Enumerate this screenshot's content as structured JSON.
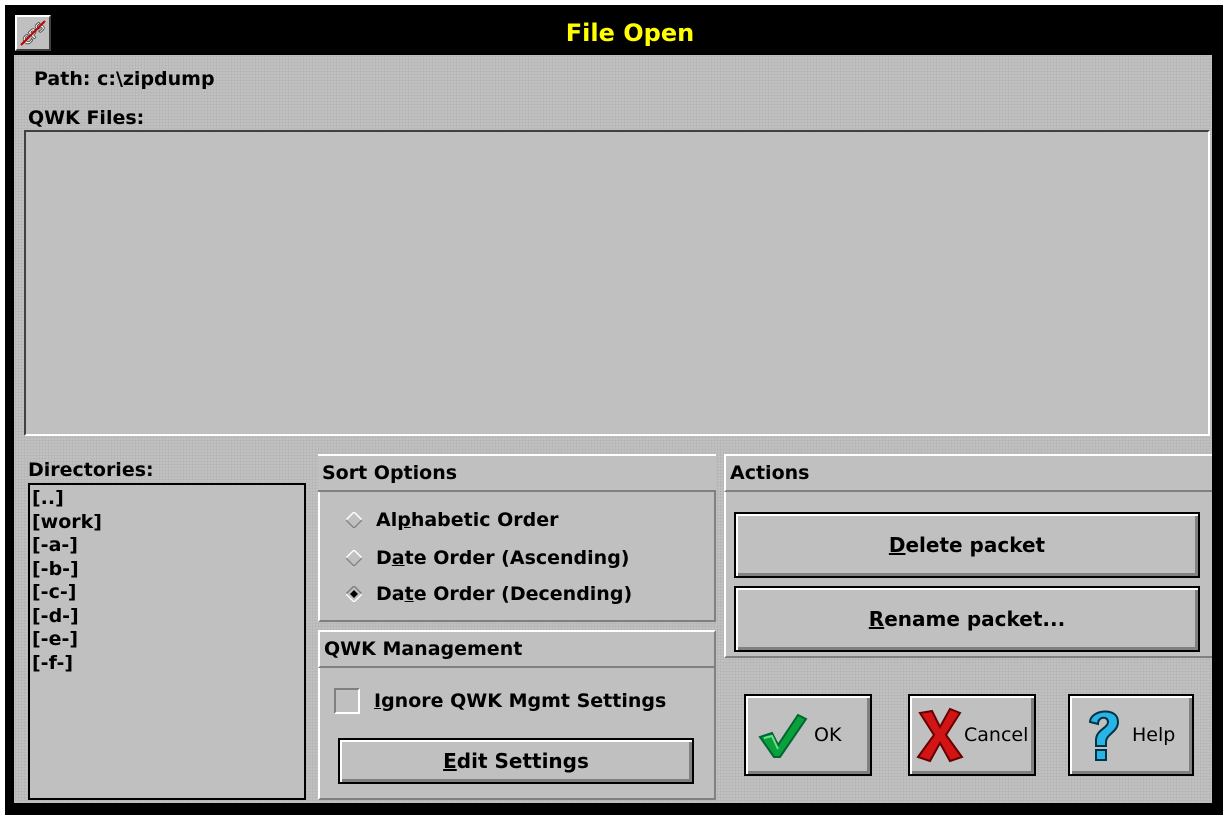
{
  "window": {
    "title": "File Open",
    "system_menu_icon": "cps-logo-icon"
  },
  "path": {
    "label": "Path:",
    "value": "c:\\zipdump"
  },
  "qwk_files": {
    "label": "QWK Files:",
    "items": []
  },
  "directories": {
    "label": "Directories:",
    "items": [
      "[..]",
      "[work]",
      "[-a-]",
      "[-b-]",
      "[-c-]",
      "[-d-]",
      "[-e-]",
      "[-f-]"
    ]
  },
  "sort_options": {
    "label": "Sort Options",
    "options": [
      {
        "pre": "Al",
        "mn": "p",
        "post": "habetic Order",
        "selected": false
      },
      {
        "pre": "D",
        "mn": "a",
        "post": "te Order (Ascending)",
        "selected": false
      },
      {
        "pre": "Da",
        "mn": "t",
        "post": "e Order (Decending)",
        "selected": true
      }
    ]
  },
  "qwk_management": {
    "label": "QWK Management",
    "ignore_checkbox": {
      "mn": "I",
      "post": "gnore QWK Mgmt Settings",
      "checked": false
    },
    "edit_button": {
      "mn": "E",
      "post": "dit Settings"
    }
  },
  "actions": {
    "label": "Actions",
    "delete_button": {
      "mn": "D",
      "post": "elete packet"
    },
    "rename_button": {
      "mn": "R",
      "post": "ename packet..."
    }
  },
  "buttons": {
    "ok": "OK",
    "cancel": "Cancel",
    "help": "Help"
  },
  "colors": {
    "title_text": "#ffff00",
    "title_bg": "#000000",
    "face": "#c0c0c0"
  }
}
